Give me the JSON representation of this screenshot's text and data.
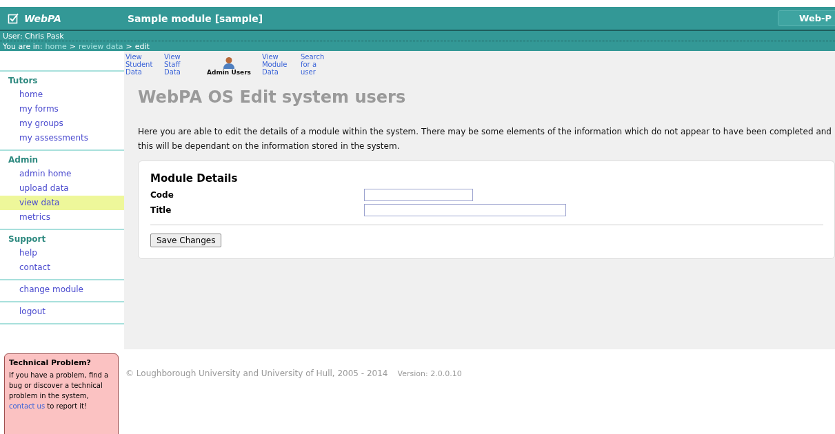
{
  "header": {
    "logo": "WebPA",
    "module": "Sample module [sample]",
    "button": "Web-P"
  },
  "user_bar": "User: Chris Pask",
  "breadcrumb": {
    "label": "You are in:",
    "crumbs": [
      {
        "text": "home",
        "kind": "link"
      },
      {
        "text": ">",
        "kind": "sep"
      },
      {
        "text": "review data",
        "kind": "link"
      },
      {
        "text": ">",
        "kind": "sep"
      },
      {
        "text": "edit",
        "kind": "current"
      }
    ]
  },
  "sidebar": {
    "sections": [
      {
        "title": "Tutors",
        "items": [
          {
            "label": "home",
            "selected": false
          },
          {
            "label": "my forms",
            "selected": false
          },
          {
            "label": "my groups",
            "selected": false
          },
          {
            "label": "my assessments",
            "selected": false
          }
        ]
      },
      {
        "title": "Admin",
        "items": [
          {
            "label": "admin home",
            "selected": false
          },
          {
            "label": "upload data",
            "selected": false
          },
          {
            "label": "view data",
            "selected": true
          },
          {
            "label": "metrics",
            "selected": false
          }
        ]
      },
      {
        "title": "Support",
        "items": [
          {
            "label": "help",
            "selected": false
          },
          {
            "label": "contact",
            "selected": false
          }
        ]
      },
      {
        "items": [
          {
            "label": "change module",
            "selected": false
          }
        ]
      },
      {
        "items": [
          {
            "label": "logout",
            "selected": false
          }
        ]
      }
    ],
    "problem": {
      "title": "Technical Problem?",
      "before": "If you have a problem, find a bug or discover a technical problem in the system,",
      "link": "contact us",
      "after": "to report it!"
    }
  },
  "toolbar": [
    {
      "kind": "text",
      "label": "View Student Data"
    },
    {
      "kind": "text",
      "label": "View Staff Data"
    },
    {
      "kind": "icon",
      "label": "Admin Users"
    },
    {
      "kind": "text",
      "label": "View Module Data"
    },
    {
      "kind": "text",
      "label": "Search for a user"
    }
  ],
  "page": {
    "title": "WebPA OS Edit system users",
    "intro": "Here you are able to edit the details of a module within the system. There may be some elements of the information which do not appear to have been completed and this will be dependant on the information stored in the system.",
    "form": {
      "heading": "Module Details",
      "fields": [
        {
          "label": "Code",
          "kind": "short"
        },
        {
          "label": "Title",
          "kind": "long"
        }
      ],
      "button": "Save Changes"
    }
  },
  "footer": {
    "copyright": "© Loughborough University and University of Hull, 2005 - 2014",
    "version": "Version: 2.0.0.10"
  }
}
